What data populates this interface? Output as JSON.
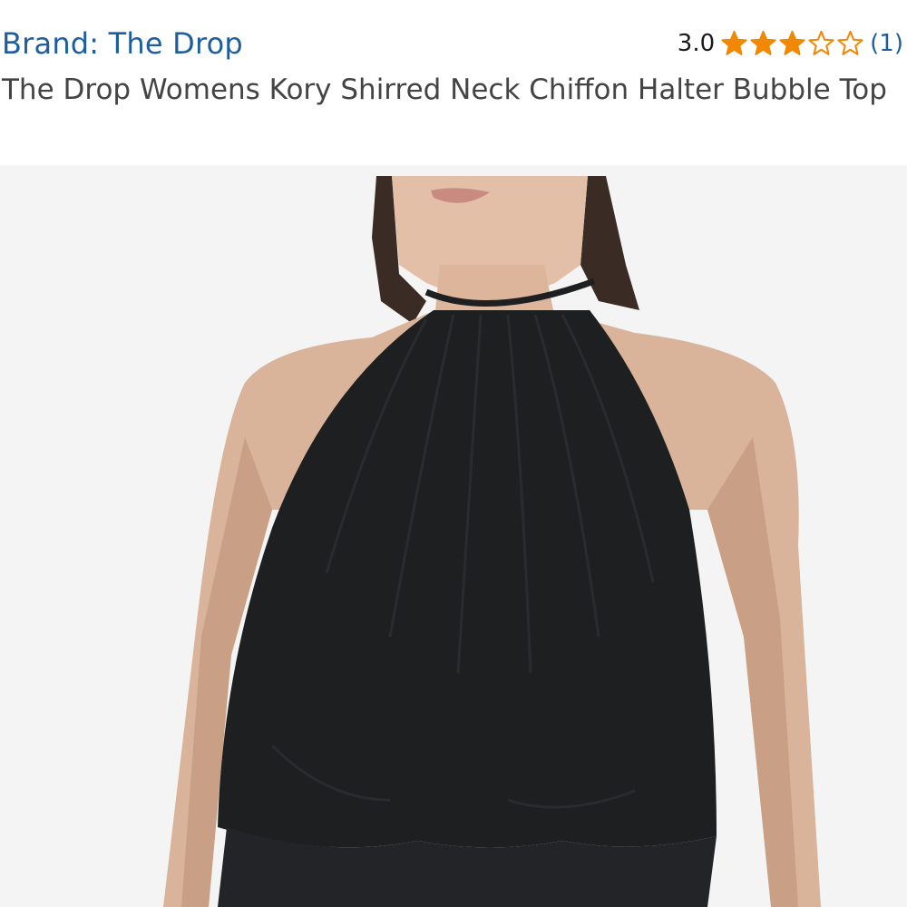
{
  "product": {
    "brand_label": "Brand: The Drop",
    "title": "The Drop Womens Kory Shirred Neck Chiffon Halter Bubble Top",
    "rating_value": "3.0",
    "rating_stars": 3,
    "rating_max": 5,
    "review_count": "(1)",
    "image_icon": "product-photo-halter-top"
  },
  "colors": {
    "link": "#1f5e9c",
    "star": "#f08804",
    "title": "#444444",
    "image_bg": "#f4f4f4",
    "garment": "#1d1f21",
    "skin": "#d9b49a"
  }
}
